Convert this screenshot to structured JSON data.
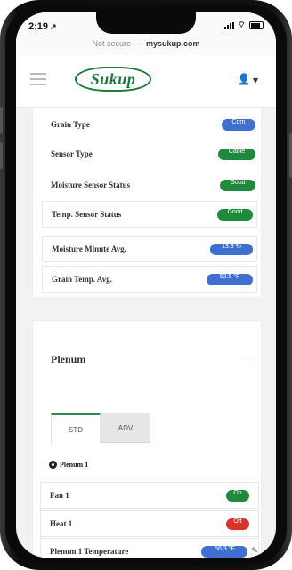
{
  "status_bar": {
    "time": "2:19",
    "time_arrow": "↗"
  },
  "url_bar": {
    "lock": "Not secure — ",
    "domain": "mysukup.com"
  },
  "header": {
    "logo_text": "Sukup",
    "user_icon": "user-icon",
    "menu_icon": "hamburger-icon"
  },
  "sensor_rows": [
    {
      "label": "Grain Type",
      "value": "Corn",
      "color": "#3f6fd1"
    },
    {
      "label": "Sensor Type",
      "value": "Cable",
      "color": "#1f8a3c"
    },
    {
      "label": "Moisture Sensor Status",
      "value": "Good",
      "color": "#1f8a3c"
    },
    {
      "label": "Temp. Sensor Status",
      "value": "Good",
      "color": "#1f8a3c"
    }
  ],
  "avg_rows": [
    {
      "label": "Moisture Minute Avg.",
      "value": "13.9 %",
      "color": "#3f6fd1"
    },
    {
      "label": "Grain Temp. Avg.",
      "value": "52.5 °F",
      "color": "#3f6fd1"
    }
  ],
  "plenum": {
    "title": "Plenum",
    "tabs": [
      {
        "label": "STD",
        "active": true
      },
      {
        "label": "ADV",
        "active": false
      }
    ],
    "group_title": "Plenum 1",
    "rows": [
      {
        "label": "Fan 1",
        "value": "On",
        "color": "#1f8a3c"
      },
      {
        "label": "Heat 1",
        "value": "Off",
        "color": "#d9332c"
      },
      {
        "label": "Plenum 1 Temperature",
        "value": "56.3 °F",
        "color": "#3f6fd1"
      }
    ]
  }
}
